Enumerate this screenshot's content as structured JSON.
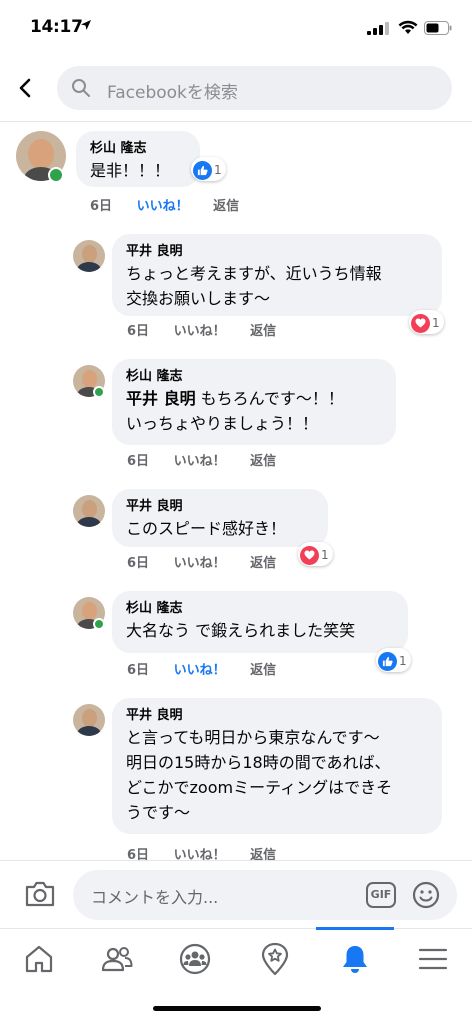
{
  "status_bar": {
    "time": "14:17"
  },
  "search": {
    "placeholder": "Facebookを検索"
  },
  "comments": [
    {
      "author": "杉山 隆志",
      "text": "是非！！！",
      "time": "6日",
      "like_label": "いいね！",
      "reply_label": "返信",
      "liked": true,
      "reaction": "like",
      "reaction_count": "1"
    },
    {
      "author": "平井 良明",
      "text": "ちょっと考えますが、近いうち情報\n交換お願いします〜",
      "time": "6日",
      "like_label": "いいね！",
      "reply_label": "返信",
      "liked": false,
      "reaction": "love",
      "reaction_count": "1"
    },
    {
      "author": "杉山 隆志",
      "mention": "平井 良明",
      "text": " もちろんです〜！！\nいっちょやりましょう！！",
      "time": "6日",
      "like_label": "いいね！",
      "reply_label": "返信",
      "liked": false
    },
    {
      "author": "平井 良明",
      "text": "このスピード感好き！",
      "time": "6日",
      "like_label": "いいね！",
      "reply_label": "返信",
      "liked": false,
      "reaction": "love",
      "reaction_count": "1"
    },
    {
      "author": "杉山 隆志",
      "text": "大名なう で鍛えられました笑笑",
      "time": "6日",
      "like_label": "いいね！",
      "reply_label": "返信",
      "liked": true,
      "reaction": "like",
      "reaction_count": "1"
    },
    {
      "author": "平井 良明",
      "text": "と言っても明日から東京なんです〜\n明日の15時から18時の間であれば、\nどこかでzoomミーティングはできそ\nうです〜",
      "time": "6日",
      "like_label": "いいね！",
      "reply_label": "返信",
      "liked": false
    }
  ],
  "composer": {
    "placeholder": "コメントを入力...",
    "gif_label": "GIF"
  },
  "tabs": [
    {
      "icon": "home-icon"
    },
    {
      "icon": "friends-icon"
    },
    {
      "icon": "groups-icon"
    },
    {
      "icon": "pages-icon"
    },
    {
      "icon": "notifications-icon",
      "active": true
    },
    {
      "icon": "menu-icon"
    }
  ],
  "colors": {
    "accent": "#1877f2",
    "love": "#f33e58",
    "online": "#31a24c",
    "bubble": "#f0f2f5"
  }
}
